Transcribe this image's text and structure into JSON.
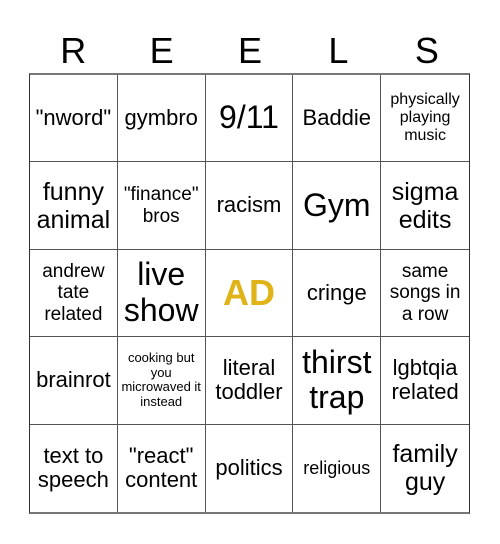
{
  "title_letters": [
    "R",
    "E",
    "E",
    "L",
    "S"
  ],
  "accent_color": "#e0b318",
  "cells": [
    {
      "text": "\"nword\"",
      "size": "md"
    },
    {
      "text": "gymbro",
      "size": "md"
    },
    {
      "text": "9/11",
      "size": "xl"
    },
    {
      "text": "Baddie",
      "size": "md"
    },
    {
      "text": "physically playing music",
      "size": "sm"
    },
    {
      "text": "funny animal",
      "size": "lg"
    },
    {
      "text": "\"finance\" bros",
      "size": "smd"
    },
    {
      "text": "racism",
      "size": "md"
    },
    {
      "text": "Gym",
      "size": "xl"
    },
    {
      "text": "sigma edits",
      "size": "lg"
    },
    {
      "text": "andrew tate related",
      "size": "smd"
    },
    {
      "text": "live show",
      "size": "xl"
    },
    {
      "text": "AD",
      "size": "free"
    },
    {
      "text": "cringe",
      "size": "md"
    },
    {
      "text": "same songs in a row",
      "size": "smd"
    },
    {
      "text": "brainrot",
      "size": "md"
    },
    {
      "text": "cooking but you microwaved it instead",
      "size": "xs"
    },
    {
      "text": "literal toddler",
      "size": "md"
    },
    {
      "text": "thirst trap",
      "size": "xl"
    },
    {
      "text": "lgbtqia related",
      "size": "md"
    },
    {
      "text": "text to speech",
      "size": "md"
    },
    {
      "text": "\"react\" content",
      "size": "md"
    },
    {
      "text": "politics",
      "size": "md"
    },
    {
      "text": "religious",
      "size": "smx"
    },
    {
      "text": "family guy",
      "size": "lg"
    }
  ]
}
